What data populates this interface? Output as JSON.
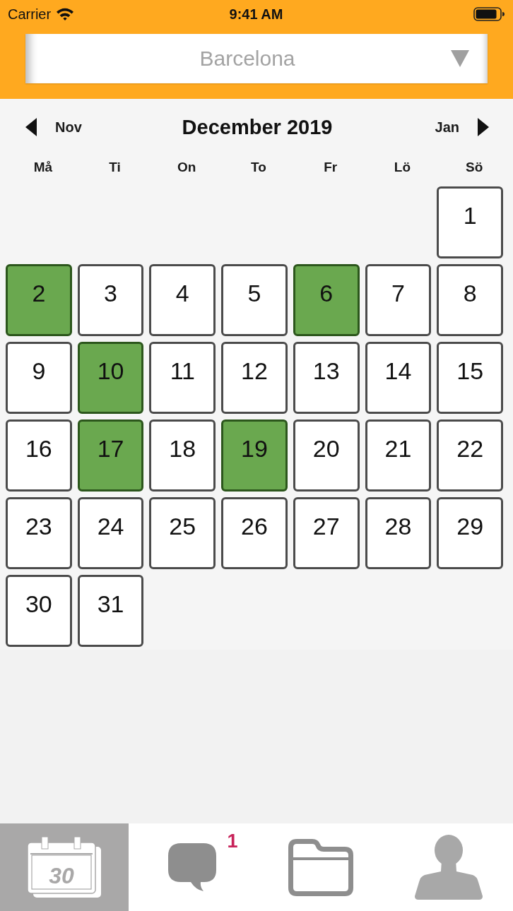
{
  "status_bar": {
    "carrier": "Carrier",
    "time": "9:41 AM"
  },
  "city_picker": {
    "value": "Barcelona"
  },
  "calendar": {
    "prev_month": "Nov",
    "title": "December 2019",
    "next_month": "Jan",
    "weekdays": [
      "Må",
      "Ti",
      "On",
      "To",
      "Fr",
      "Lö",
      "Sö"
    ],
    "weeks": [
      {
        "days": [
          {
            "label": "1",
            "selected": false
          }
        ]
      },
      {
        "days": [
          {
            "label": "2",
            "selected": true
          },
          {
            "label": "3",
            "selected": false
          },
          {
            "label": "4",
            "selected": false
          },
          {
            "label": "5",
            "selected": false
          },
          {
            "label": "6",
            "selected": true
          },
          {
            "label": "7",
            "selected": false
          },
          {
            "label": "8",
            "selected": false
          }
        ]
      },
      {
        "days": [
          {
            "label": "9",
            "selected": false
          },
          {
            "label": "10",
            "selected": true
          },
          {
            "label": "11",
            "selected": false
          },
          {
            "label": "12",
            "selected": false
          },
          {
            "label": "13",
            "selected": false
          },
          {
            "label": "14",
            "selected": false
          },
          {
            "label": "15",
            "selected": false
          }
        ]
      },
      {
        "days": [
          {
            "label": "16",
            "selected": false
          },
          {
            "label": "17",
            "selected": true
          },
          {
            "label": "18",
            "selected": false
          },
          {
            "label": "19",
            "selected": true
          },
          {
            "label": "20",
            "selected": false
          },
          {
            "label": "21",
            "selected": false
          },
          {
            "label": "22",
            "selected": false
          }
        ]
      },
      {
        "days": [
          {
            "label": "23",
            "selected": false
          },
          {
            "label": "24",
            "selected": false
          },
          {
            "label": "25",
            "selected": false
          },
          {
            "label": "26",
            "selected": false
          },
          {
            "label": "27",
            "selected": false
          },
          {
            "label": "28",
            "selected": false
          },
          {
            "label": "29",
            "selected": false
          }
        ]
      },
      {
        "days": [
          {
            "label": "30",
            "selected": false
          },
          {
            "label": "31",
            "selected": false
          }
        ]
      }
    ]
  },
  "tab_bar": {
    "tabs": [
      {
        "kind": "calendar",
        "selected": true,
        "icon_label": "30"
      },
      {
        "kind": "messages",
        "selected": false,
        "badge": "1"
      },
      {
        "kind": "folder",
        "selected": false
      },
      {
        "kind": "profile",
        "selected": false
      }
    ]
  }
}
